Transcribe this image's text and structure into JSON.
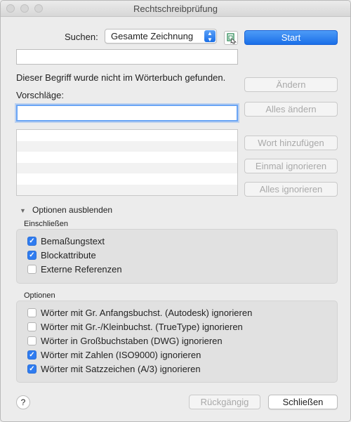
{
  "window": {
    "title": "Rechtschreibprüfung"
  },
  "search": {
    "label": "Suchen:",
    "selected": "Gesamte Zeichnung",
    "field_value": ""
  },
  "status_text": "Dieser Begriff wurde nicht im Wörterbuch gefunden.",
  "suggestions": {
    "label": "Vorschläge:",
    "field_value": "",
    "items": []
  },
  "buttons": {
    "start": "Start",
    "change": "Ändern",
    "change_all": "Alles ändern",
    "add_word": "Wort hinzufügen",
    "ignore_once": "Einmal ignorieren",
    "ignore_all": "Alles ignorieren",
    "undo": "Rückgängig",
    "close": "Schließen",
    "help": "?"
  },
  "options_toggle": {
    "label": "Optionen ausblenden",
    "icon": "triangle-down-icon"
  },
  "include": {
    "title": "Einschließen",
    "items": [
      {
        "label": "Bemaßungstext",
        "checked": true
      },
      {
        "label": "Blockattribute",
        "checked": true
      },
      {
        "label": "Externe Referenzen",
        "checked": false
      }
    ]
  },
  "options": {
    "title": "Optionen",
    "items": [
      {
        "label": "Wörter mit Gr. Anfangsbuchst. (Autodesk) ignorieren",
        "checked": false
      },
      {
        "label": "Wörter mit Gr.-/Kleinbuchst. (TrueType) ignorieren",
        "checked": false
      },
      {
        "label": "Wörter in Großbuchstaben (DWG) ignorieren",
        "checked": false
      },
      {
        "label": "Wörter mit Zahlen (ISO9000) ignorieren",
        "checked": true
      },
      {
        "label": "Wörter mit Satzzeichen (A/3) ignorieren",
        "checked": true
      }
    ]
  },
  "colors": {
    "accent": "#1a6fe8",
    "checkbox_on": "#2f7cf0"
  }
}
